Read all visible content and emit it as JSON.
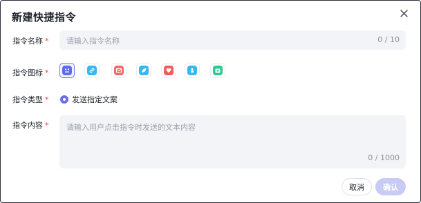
{
  "dialog": {
    "title": "新建快捷指令",
    "close_icon": "close-icon"
  },
  "form": {
    "name": {
      "label": "指令名称",
      "required_mark": "*",
      "placeholder": "请输入指令名称",
      "counter": "0 / 10"
    },
    "icon": {
      "label": "指令图标",
      "required_mark": "*",
      "options": [
        {
          "name": "robot-icon",
          "color": "#5b6ee8",
          "selected": true
        },
        {
          "name": "link-icon",
          "color": "#35b7f2",
          "selected": false
        },
        {
          "name": "mail-icon",
          "color": "#f26b6b",
          "selected": false
        },
        {
          "name": "leaf-icon",
          "color": "#35b7f2",
          "selected": false
        },
        {
          "name": "heart-icon",
          "color": "#f25c5c",
          "selected": false
        },
        {
          "name": "person-icon",
          "color": "#35b7f2",
          "selected": false
        },
        {
          "name": "medical-icon",
          "color": "#2ec98f",
          "selected": false
        }
      ]
    },
    "type": {
      "label": "指令类型",
      "required_mark": "*",
      "option_label": "发送指定文案",
      "accent": "#6a6ee8"
    },
    "content": {
      "label": "指令内容",
      "required_mark": "*",
      "placeholder": "请输入用户点击指令时发送的文本内容",
      "counter": "0 / 1000"
    }
  },
  "footer": {
    "cancel_label": "取消",
    "confirm_label": "确认"
  }
}
